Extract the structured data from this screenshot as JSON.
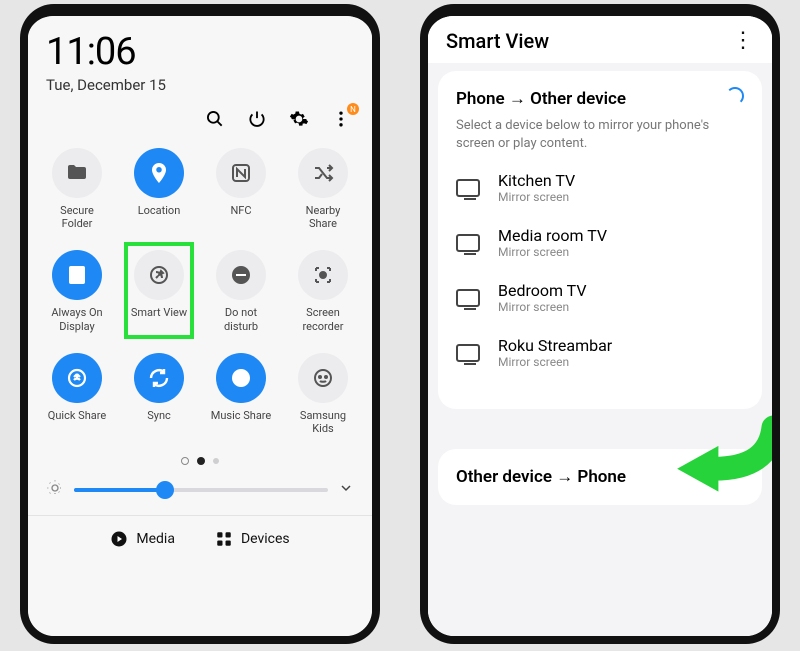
{
  "left": {
    "time": "11:06",
    "date": "Tue, December 15",
    "badge": "N",
    "tiles": [
      {
        "label": "Secure\nFolder",
        "on": false,
        "icon": "folder"
      },
      {
        "label": "Location",
        "on": true,
        "icon": "pin"
      },
      {
        "label": "NFC",
        "on": false,
        "icon": "nfc"
      },
      {
        "label": "Nearby\nShare",
        "on": false,
        "icon": "shuffle"
      },
      {
        "label": "Always On\nDisplay",
        "on": true,
        "icon": "clock"
      },
      {
        "label": "Smart View",
        "on": false,
        "icon": "cast",
        "highlight": true
      },
      {
        "label": "Do not\ndisturb",
        "on": false,
        "icon": "minus"
      },
      {
        "label": "Screen\nrecorder",
        "on": false,
        "icon": "record"
      },
      {
        "label": "Quick Share",
        "on": true,
        "icon": "share"
      },
      {
        "label": "Sync",
        "on": true,
        "icon": "sync"
      },
      {
        "label": "Music Share",
        "on": true,
        "icon": "music"
      },
      {
        "label": "Samsung\nKids",
        "on": false,
        "icon": "kids"
      }
    ],
    "bottom": {
      "media": "Media",
      "devices": "Devices"
    }
  },
  "right": {
    "title": "Smart View",
    "section1": {
      "heading": "Phone → Other device",
      "desc": "Select a device below to mirror your phone's screen or play content."
    },
    "devices": [
      {
        "name": "Kitchen TV",
        "sub": "Mirror screen"
      },
      {
        "name": "Media room TV",
        "sub": "Mirror screen"
      },
      {
        "name": "Bedroom TV",
        "sub": "Mirror screen"
      },
      {
        "name": "Roku Streambar",
        "sub": "Mirror screen"
      }
    ],
    "section2": {
      "heading": "Other device → Phone"
    }
  }
}
